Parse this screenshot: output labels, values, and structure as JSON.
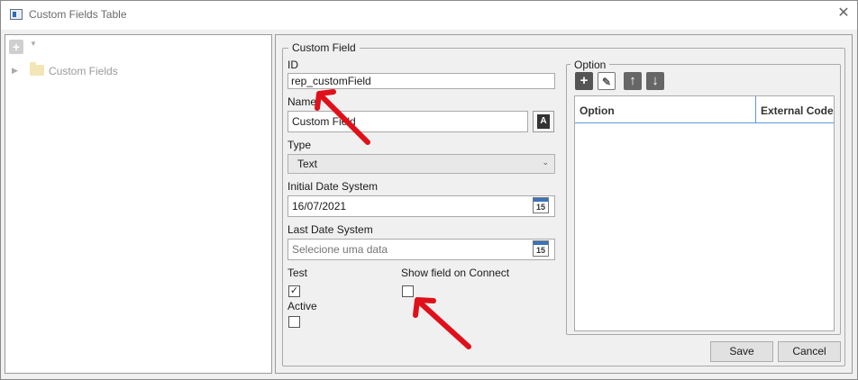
{
  "window": {
    "title": "Custom Fields Table"
  },
  "tree": {
    "root_label": "Custom Fields"
  },
  "custom_field": {
    "group_title": "Custom Field",
    "id_label": "ID",
    "id_value": "rep_customField",
    "name_label": "Name",
    "name_value": "Custom Field",
    "type_label": "Type",
    "type_value": "Text",
    "initial_date_label": "Initial Date System",
    "initial_date_value": "16/07/2021",
    "last_date_label": "Last Date System",
    "last_date_placeholder": "Selecione uma data",
    "calendar_day": "15",
    "test_label": "Test",
    "test_checked": true,
    "show_on_connect_label": "Show field on Connect",
    "show_on_connect_checked": false,
    "active_label": "Active",
    "active_checked": false
  },
  "option": {
    "group_title": "Option",
    "columns": [
      "Option",
      "External Code"
    ]
  },
  "buttons": {
    "save": "Save",
    "cancel": "Cancel"
  },
  "colors": {
    "annotation_arrow": "#e0101a",
    "calendar_accent": "#3a73b8"
  }
}
